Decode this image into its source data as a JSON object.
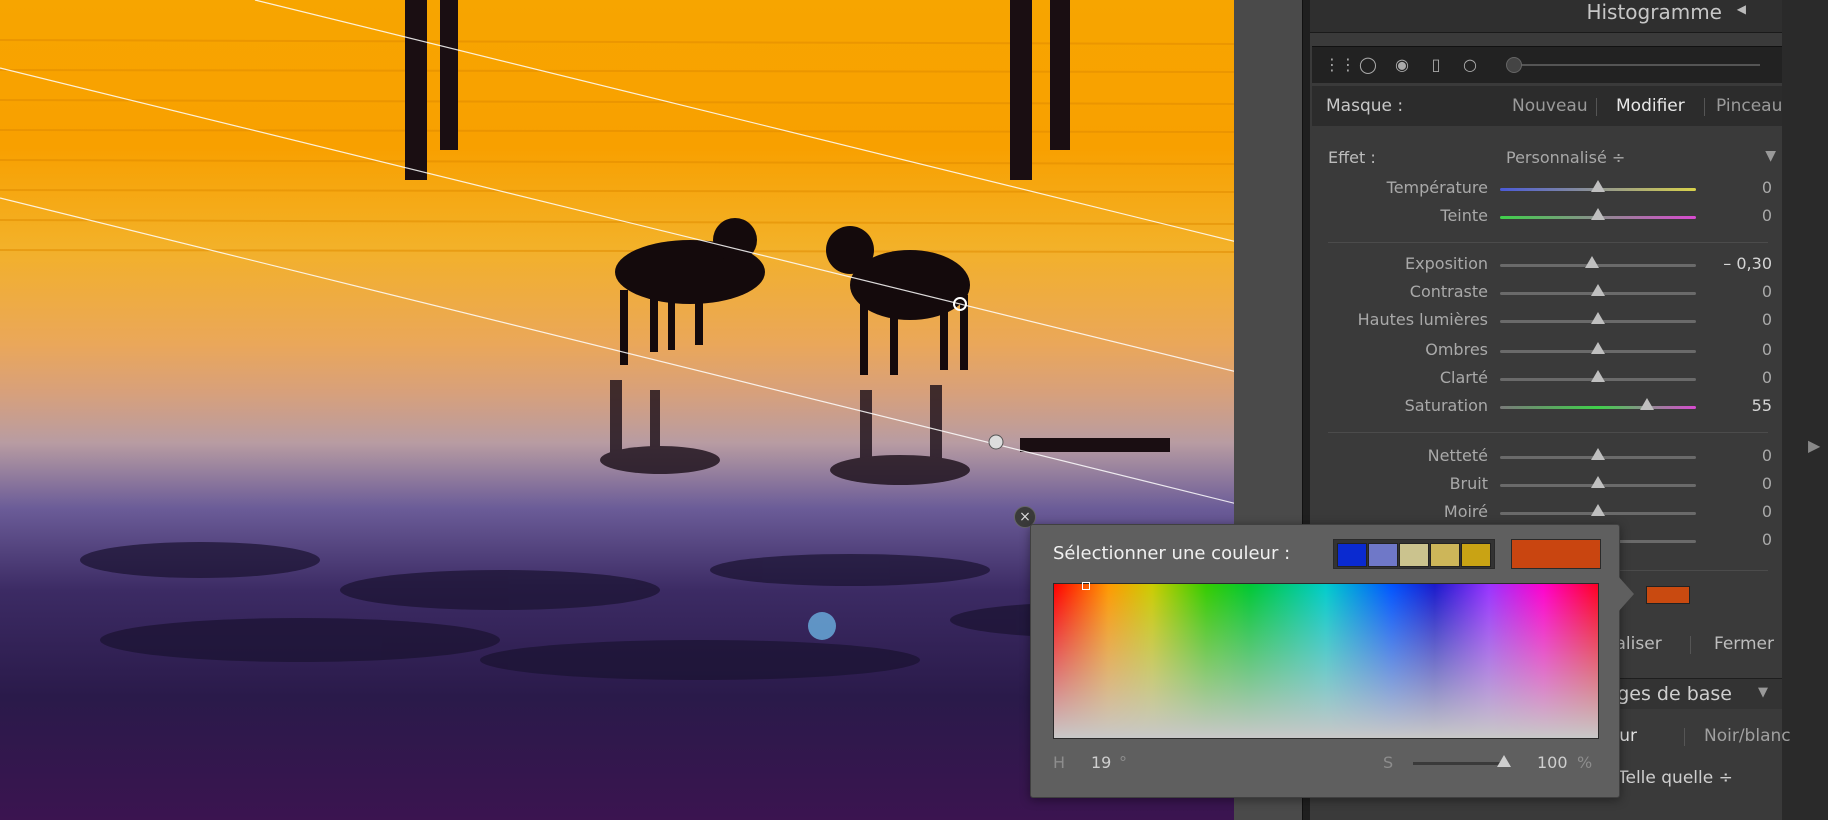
{
  "panel": {
    "title": "Histogramme"
  },
  "mask": {
    "label": "Masque :",
    "new": "Nouveau",
    "edit": "Modifier",
    "brush": "Pinceau"
  },
  "effect": {
    "label": "Effet :",
    "value": "Personnalisé ÷"
  },
  "sliders": [
    {
      "label": "Température",
      "value": "0",
      "level": 0.5,
      "track": "temp"
    },
    {
      "label": "Teinte",
      "value": "0",
      "level": 0.5,
      "track": "tint"
    },
    {
      "label": "Exposition",
      "value": "– 0,30",
      "level": 0.47,
      "track": "gray"
    },
    {
      "label": "Contraste",
      "value": "0",
      "level": 0.5,
      "track": "gray"
    },
    {
      "label": "Hautes lumières",
      "value": "0",
      "level": 0.5,
      "track": "gray"
    },
    {
      "label": "Ombres",
      "value": "0",
      "level": 0.5,
      "track": "gray"
    },
    {
      "label": "Clarté",
      "value": "0",
      "level": 0.5,
      "track": "gray"
    },
    {
      "label": "Saturation",
      "value": "55",
      "level": 0.75,
      "track": "sat"
    },
    {
      "label": "Netteté",
      "value": "0",
      "level": 0.5,
      "track": "gray"
    },
    {
      "label": "Bruit",
      "value": "0",
      "level": 0.5,
      "track": "gray"
    },
    {
      "label": "Moiré",
      "value": "0",
      "level": 0.5,
      "track": "gray"
    },
    {
      "label": "",
      "value": "0",
      "level": 0.5,
      "track": "gray"
    }
  ],
  "bottom": {
    "reset": "dialiser",
    "close": "Fermer"
  },
  "section": {
    "title": "ages de base"
  },
  "treatment": {
    "color": "ueur",
    "bw": "Noir/blanc"
  },
  "profile": {
    "value": "Telle quelle ÷"
  },
  "popup": {
    "title": "Sélectionner une couleur :",
    "presets": [
      "#0a2ad0",
      "#6f78c8",
      "#cbc38e",
      "#cdb659",
      "#c9a314"
    ],
    "current_color": "#c94510",
    "h_label": "H",
    "h_value": "19",
    "h_unit": "°",
    "s_label": "S",
    "s_value": "100",
    "s_unit": "%",
    "s_level": 1.0
  },
  "colors": {
    "panel_bg": "#3a3a3a",
    "photo_sky": "#f7a500",
    "selected_color": "#c94a10"
  }
}
